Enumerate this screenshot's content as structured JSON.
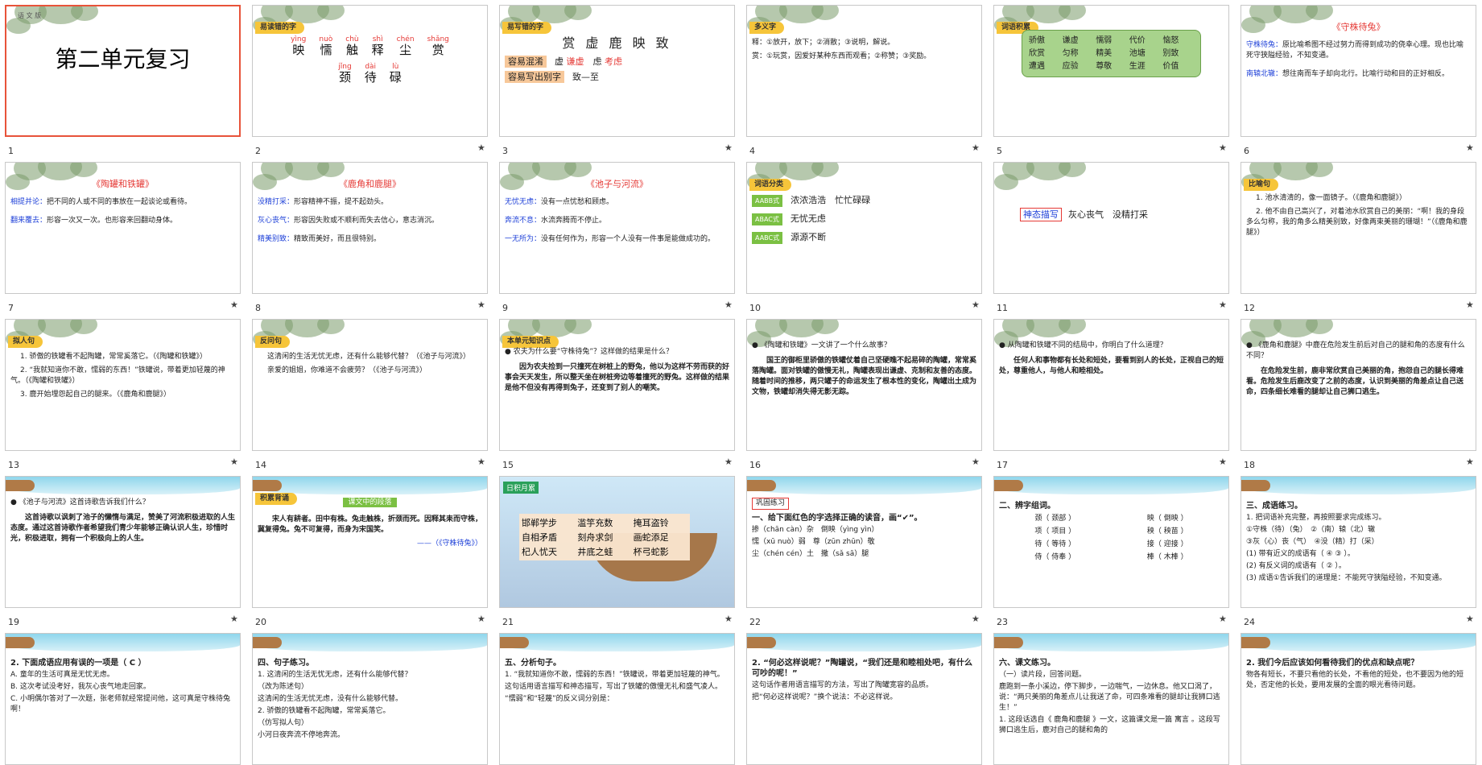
{
  "slides": [
    {
      "num": "1",
      "title": "第二单元复习",
      "corner": "语 文 版"
    },
    {
      "num": "2",
      "banner": "易读错的字",
      "pinyin": [
        [
          "yìng",
          "映"
        ],
        [
          "nuò",
          "懦"
        ],
        [
          "chù",
          "触"
        ],
        [
          "shì",
          "释"
        ],
        [
          "chén",
          "尘"
        ],
        [
          "shǎng",
          "赏"
        ],
        [
          "jǐng",
          "颈"
        ],
        [
          "dài",
          "待"
        ],
        [
          "lù",
          "碌"
        ]
      ]
    },
    {
      "num": "3",
      "banner": "易写错的字",
      "chars": "赏 虚 鹿 映 致",
      "l1": "容易混淆",
      "l1a": "虚",
      "l1b": "谦虚",
      "l1c": "虑",
      "l1d": "考虑",
      "l2": "容易写出别字",
      "l2a": "致—至"
    },
    {
      "num": "4",
      "banner": "多义字",
      "lines": [
        "释：①放开，放下；②消散；③说明，解说。",
        "赏：①玩赏，因爱好某种东西而观看；②称赞；③奖励。"
      ]
    },
    {
      "num": "5",
      "banner": "词语积累",
      "words": [
        "骄傲",
        "谦虚",
        "懦弱",
        "代价",
        "恼怒",
        "欣赏",
        "匀称",
        "精美",
        "池塘",
        "别致",
        "遭遇",
        "应验",
        "尊敬",
        "生涯",
        "价值"
      ]
    },
    {
      "num": "6",
      "title": "《守株待兔》",
      "items": [
        [
          "守株待兔：",
          "原比喻希图不经过努力而得到成功的侥幸心理。现也比喻死守狭隘经验，不知变通。"
        ],
        [
          "南辕北辙：",
          "想往南而车子却向北行。比喻行动和目的正好相反。"
        ]
      ]
    },
    {
      "num": "7",
      "title": "《陶罐和铁罐》",
      "items": [
        [
          "相提并论：",
          "把不同的人或不同的事放在一起谈论或看待。"
        ],
        [
          "翻来覆去：",
          "形容一次又一次。也形容来回翻动身体。"
        ]
      ]
    },
    {
      "num": "8",
      "title": "《鹿角和鹿腿》",
      "items": [
        [
          "没精打采：",
          "形容精神不振，提不起劲头。"
        ],
        [
          "灰心丧气：",
          "形容因失败或不顺利而失去信心，意志消沉。"
        ],
        [
          "精美别致：",
          "精致而美好，而且很特别。"
        ]
      ]
    },
    {
      "num": "9",
      "title": "《池子与河流》",
      "items": [
        [
          "无忧无虑：",
          "没有一点忧愁和顾虑。"
        ],
        [
          "奔流不息：",
          "水流奔腾而不停止。"
        ],
        [
          "一无所为：",
          "没有任何作为，形容一个人没有一件事是能做成功的。"
        ]
      ]
    },
    {
      "num": "10",
      "banner": "词语分类",
      "rows": [
        [
          "AABB式",
          "浓浓浩浩",
          "忙忙碌碌"
        ],
        [
          "ABAC式",
          "无忧无虑",
          ""
        ],
        [
          "AABC式",
          "源源不断",
          ""
        ]
      ]
    },
    {
      "num": "11",
      "label": "神态描写",
      "words": "灰心丧气　没精打采"
    },
    {
      "num": "12",
      "banner": "比喻句",
      "lines": [
        "1. 池水清清的，像一面镜子。（《鹿角和鹿腿》）",
        "2. 他不由自己高兴了，对着池水欣赏自己的美丽：“啊！我的身段多么匀称，我的角多么精美别致，好像两束美丽的珊瑚！”（《鹿角和鹿腿》）"
      ]
    },
    {
      "num": "13",
      "banner": "拟人句",
      "lines": [
        "1. 骄傲的铁罐看不起陶罐，常常奚落它。（《陶罐和铁罐》）",
        "2. “我就知道你不敢，懦弱的东西！”铁罐说，带着更加轻蔑的神气。（《陶罐和铁罐》）",
        "3. 鹿开始埋怨起自己的腿来。（《鹿角和鹿腿》）"
      ]
    },
    {
      "num": "14",
      "banner": "反问句",
      "lines": [
        "这清闲的生活无忧无虑，还有什么能够代替？（《池子与河流》）",
        "亲爱的姐姐，你难道不会疲劳？（《池子与河流》）"
      ]
    },
    {
      "num": "15",
      "banner": "本单元知识点",
      "q": "农夫为什么要“守株待兔”？这样做的结果是什么？",
      "a": "因为农夫捡到一只撞死在树桩上的野兔，他以为这样不劳而获的好事会天天发生，所以整天坐在树桩旁边等着撞死的野兔。这样做的结果是他不但没有再得到兔子，还变到了别人的嘲笑。"
    },
    {
      "num": "16",
      "q": "《陶罐和铁罐》一文讲了一个什么故事？",
      "a": "国王的御柜里骄傲的铁罐仗着自己坚硬瞧不起易碎的陶罐，常常奚落陶罐。面对铁罐的傲慢无礼，陶罐表现出谦虚、克制和友善的态度。随着时间的推移，两只罐子的命运发生了根本性的变化，陶罐出土成为文物，铁罐却消失得无影无踪。"
    },
    {
      "num": "17",
      "q": "从陶罐和铁罐不同的结局中，你明白了什么道理？",
      "a": "任何人和事物都有长处和短处，要看到别人的长处，正视自己的短处，尊重他人，与他人和睦相处。"
    },
    {
      "num": "18",
      "q": "《鹿角和鹿腿》中鹿在危险发生前后对自己的腿和角的态度有什么不同？",
      "a": "在危险发生前，鹿非常欣赏自己美丽的角，抱怨自己的腿长得难看。危险发生后鹿改变了之前的态度，认识到美丽的角差点让自己送命，四条细长难看的腿却让自己狮口逃生。"
    },
    {
      "num": "19",
      "q": "《池子与河流》这首诗歌告诉我们什么？",
      "a": "这首诗歌以讽刺了池子的懒惰与满足，赞美了河流积极进取的人生态度。通过这首诗歌作者希望我们青少年能够正确认识人生，珍惜时光，积极进取，拥有一个积极向上的人生。"
    },
    {
      "num": "20",
      "banner": "积累背诵",
      "tag": "课文中的段落",
      "lines": [
        "宋人有耕者。田中有株。兔走触株，折颈而死。因释其耒而守株，冀复得兔。兔不可复得，而身为宋国笑。",
        "——（《守株待兔》）"
      ]
    },
    {
      "num": "21",
      "label": "日积月累",
      "idioms": [
        "邯郸学步",
        "滥竽充数",
        "掩耳盗铃",
        "自相矛盾",
        "刻舟求剑",
        "画蛇添足",
        "杞人忧天",
        "井底之蛙",
        "杯弓蛇影"
      ]
    },
    {
      "num": "22",
      "label": "巩固练习",
      "head": "一、给下面红色的字选择正确的读音，画“✔”。",
      "lines": [
        "掺（chān càn）杂　倒映（yìng yìn）",
        "懦（xū nuò）弱　尊（zūn zhūn）敬",
        "尘（chén cén）土　撒（sǎ sā）腿"
      ]
    },
    {
      "num": "23",
      "head": "二、辨字组词。",
      "pairs": [
        [
          "颈（ 颈部 ）",
          "映（ 倒映 ）"
        ],
        [
          "项（ 项目 ）",
          "秧（ 秧苗 ）"
        ],
        [
          "待（ 等待 ）",
          "接（ 迎接 ）"
        ],
        [
          "侍（ 侍奉 ）",
          "棒（ 木棒 ）"
        ]
      ]
    },
    {
      "num": "24",
      "head": "三、成语练习。",
      "lines": [
        "1. 把词语补充完整，再按照要求完成练习。",
        "①守株（待）（兔）　②（南）辕（北）辙",
        "③灰（心）丧（气）　④没（精）打（采）",
        "(1) 带有近义的成语有（ ④ ③ ）。",
        "(2) 有反义词的成语有（ ② ）。",
        "(3) 成语①告诉我们的道理是：不能死守狭隘经验，不知变通。"
      ]
    },
    {
      "num": "",
      "head": "2. 下面成语应用有误的一项是（ C ）",
      "lines": [
        "A. 童年的生活可真是无忧无虑。",
        "B. 这次考试没考好，我灰心丧气地走回家。",
        "C. 小明偶尔答对了一次题，张老师就经常提问他，这可真是守株待兔啊！"
      ]
    },
    {
      "num": "",
      "head": "四、句子练习。",
      "lines": [
        "1. 这清闲的生活无忧无虑，还有什么能够代替？",
        "（改为陈述句）",
        "这清闲的生活无忧无虑，没有什么能够代替。",
        "2. 骄傲的铁罐看不起陶罐，常常奚落它。",
        "（仿写拟人句）",
        "小河日夜奔流不停地奔流。"
      ]
    },
    {
      "num": "",
      "head": "五、分析句子。",
      "lines": [
        "1. “我就知道你不敢，懦弱的东西！”铁罐说，带着更加轻蔑的神气。",
        "这句话用语言描写和神态描写，写出了铁罐的傲慢无礼和盛气凌人。",
        "“懦弱”和“轻蔑”的反义词分别是："
      ]
    },
    {
      "num": "",
      "head": "2. “何必这样说呢？”陶罐说，“我们还是和睦相处吧，有什么可吵的呢！”",
      "lines": [
        "这句话作者用语言描写的方法，写出了陶罐宽容的品质。",
        "把“何必这样说呢？”换个说法：不必这样说。"
      ]
    },
    {
      "num": "",
      "head": "六、课文练习。",
      "lines": [
        "（一）读片段，回答问题。",
        "鹿跑到一条小溪边，停下脚步，一边喘气，一边休息。他又口渴了，说：“两只美丽的角差点儿让我送了命，可四条难看的腿却让我狮口逃生！”",
        "1. 这段话选自《 鹿角和鹿腿 》一文，这篇课文是一篇 寓言 。这段写狮口逃生后，鹿对自己的腿和角的"
      ]
    },
    {
      "num": "",
      "head": "2. 我们今后应该如何看待我们的优点和缺点呢？",
      "lines": [
        "物各有短长，不要只看他的长处，不看他的短处，也不要因为他的短处，否定他的长处，要用发展的全面的眼光看待问题。"
      ]
    }
  ],
  "colors": {
    "accent": "#e8533a",
    "red": "#e53935",
    "blue": "#1e40d8",
    "banner": "#f6c53a",
    "green": "#7bc043"
  }
}
